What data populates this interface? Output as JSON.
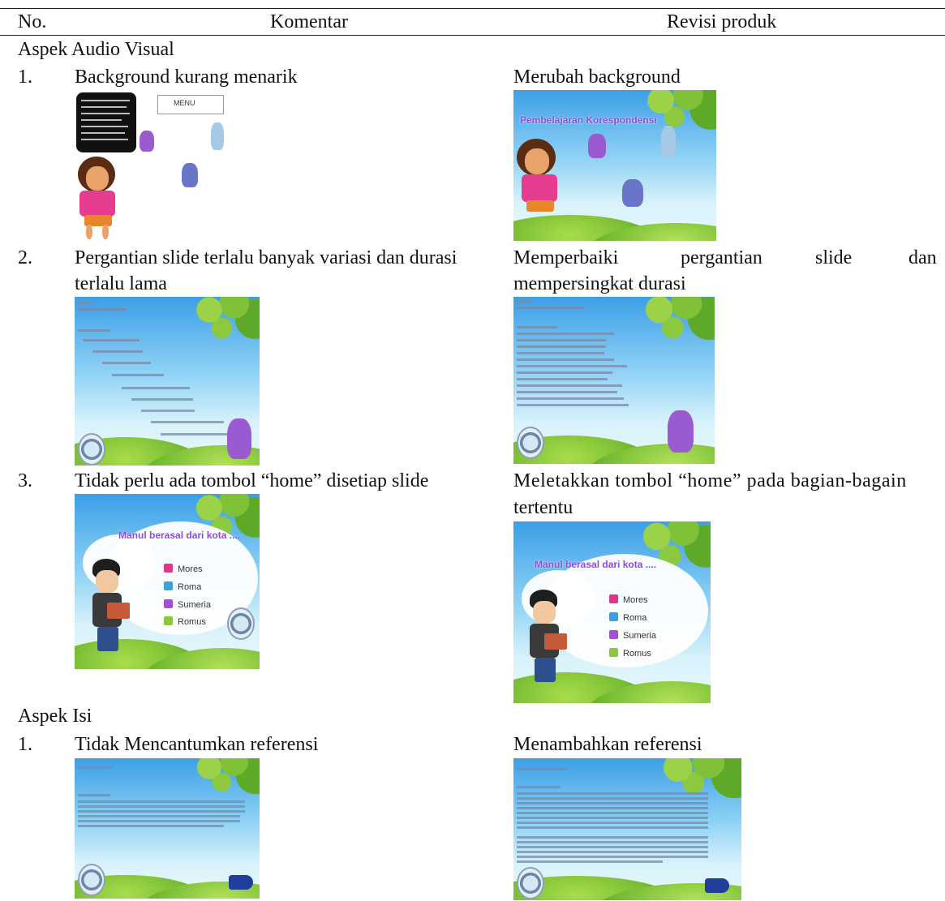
{
  "header": {
    "col_no": "No.",
    "col_komentar": "Komentar",
    "col_revisi": "Revisi produk"
  },
  "sections": [
    {
      "title": "Aspek Audio Visual",
      "rows": [
        {
          "no": "1.",
          "komentar": "Background kurang menarik",
          "revisi": "Merubah background",
          "before_slide": {
            "menu_label": "MENU"
          },
          "after_slide": {
            "title": "Pembelajaran Korespondensi"
          }
        },
        {
          "no": "2.",
          "komentar_line1": "Pergantian slide terlalu banyak variasi dan durasi",
          "komentar_line2": "terlalu lama",
          "revisi_words": [
            "Memperbaiki",
            "pergantian",
            "slide",
            "dan"
          ],
          "revisi_line2": "mempersingkat durasi"
        },
        {
          "no": "3.",
          "komentar": "Tidak perlu ada tombol “home” disetiap slide",
          "revisi_line1": "Meletakkan tombol “home” pada bagian-bagain",
          "revisi_line2": "tertentu",
          "slide_question": "Manul berasal dari kota ....",
          "options": [
            "Mores",
            "Roma",
            "Sumeria",
            "Romus"
          ]
        }
      ]
    },
    {
      "title": "Aspek Isi",
      "rows": [
        {
          "no": "1.",
          "komentar": "Tidak Mencantumkan referensi",
          "revisi": "Menambahkan referensi"
        }
      ]
    }
  ],
  "colors": {
    "option_boxes": [
      "#e0338f",
      "#3aa0e0",
      "#a64fd6",
      "#8cc63f"
    ]
  }
}
